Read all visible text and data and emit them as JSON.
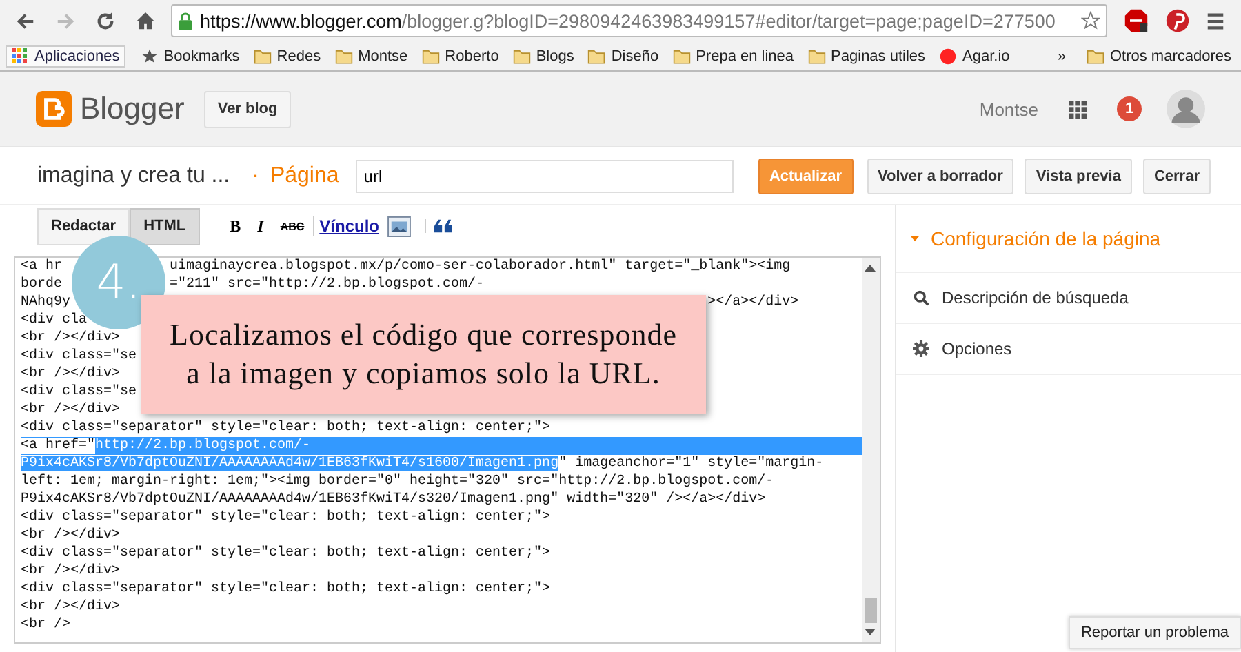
{
  "browser": {
    "url_host": "https://www.blogger.com",
    "url_path": "/blogger.g?blogID=2980942463983499157#editor/target=page;pageID=277500"
  },
  "bookmarks": [
    {
      "label": "Aplicaciones",
      "kind": "apps"
    },
    {
      "label": "Bookmarks",
      "kind": "star"
    },
    {
      "label": "Redes",
      "kind": "folder"
    },
    {
      "label": "Montse",
      "kind": "folder"
    },
    {
      "label": "Roberto",
      "kind": "folder"
    },
    {
      "label": "Blogs",
      "kind": "folder"
    },
    {
      "label": "Diseño",
      "kind": "folder"
    },
    {
      "label": "Prepa en linea",
      "kind": "folder"
    },
    {
      "label": "Paginas utiles",
      "kind": "folder"
    },
    {
      "label": "Agar.io",
      "kind": "site"
    }
  ],
  "bookmarks_more": "»",
  "other_bookmarks": "Otros marcadores",
  "header": {
    "brand": "Blogger",
    "view_blog": "Ver blog",
    "user": "Montse",
    "notifications": "1"
  },
  "editor": {
    "blog_title": "imagina y crea tu ...",
    "separator": "·",
    "page_label": "Página",
    "title_value": "url",
    "buttons": [
      {
        "label": "Actualizar",
        "primary": true
      },
      {
        "label": "Volver a borrador",
        "primary": false
      },
      {
        "label": "Vista previa",
        "primary": false
      },
      {
        "label": "Cerrar",
        "primary": false
      }
    ]
  },
  "modes": [
    {
      "label": "Redactar",
      "selected": false
    },
    {
      "label": "HTML",
      "selected": true
    }
  ],
  "format_tools": [
    {
      "kind": "bold",
      "label": "B"
    },
    {
      "kind": "italic",
      "label": "I"
    },
    {
      "kind": "strike",
      "label": "ABC"
    },
    {
      "kind": "link",
      "label": "Vínculo"
    },
    {
      "kind": "image"
    },
    {
      "kind": "quote"
    }
  ],
  "code_lines": [
    {
      "segments": [
        {
          "text": "<a hr",
          "selected": false
        }
      ],
      "tail": "uimaginaycrea.blogspot.mx/p/como-ser-colaborador.html\" target=\"_blank\"><img",
      "kind": "under_badge"
    },
    {
      "segments": [
        {
          "text": "borde",
          "selected": false
        }
      ],
      "tail": "=\"211\" src=\"http://2.bp.blogspot.com/-",
      "kind": "under_badge"
    },
    {
      "segments": [
        {
          "text": "NAhq9y",
          "selected": false
        }
      ],
      "tail": "></a></div>",
      "kind": "under_note"
    },
    {
      "segments": [
        {
          "text": "<div cla",
          "selected": false
        }
      ]
    },
    {
      "segments": [
        {
          "text": "<br /></div>",
          "selected": false
        }
      ]
    },
    {
      "segments": [
        {
          "text": "<div class=\"se",
          "selected": false
        }
      ]
    },
    {
      "segments": [
        {
          "text": "<br /></div>",
          "selected": false
        }
      ]
    },
    {
      "segments": [
        {
          "text": "<div class=\"se",
          "selected": false
        }
      ]
    },
    {
      "segments": [
        {
          "text": "<br /></div>",
          "selected": false
        }
      ]
    },
    {
      "segments": [
        {
          "text": "<div class=\"separator\" style=\"clear: both; text-align: center;\">",
          "selected": false
        }
      ]
    },
    {
      "segments": [
        {
          "text": "<a href=\"",
          "selected": false
        },
        {
          "text": "http://2.bp.blogspot.com/-",
          "selected": true
        }
      ],
      "fill": true
    },
    {
      "segments": [
        {
          "text": "P9ix4cAKSr8/Vb7dptOuZNI/AAAAAAAAd4w/1EB63fKwiT4/s1600/Imagen1.png",
          "selected": true
        },
        {
          "text": "\" imageanchor=\"1\" style=\"margin-",
          "selected": false
        }
      ]
    },
    {
      "segments": [
        {
          "text": "left: 1em; margin-right: 1em;\"><img border=\"0\" height=\"320\" src=\"http://2.bp.blogspot.com/-",
          "selected": false
        }
      ]
    },
    {
      "segments": [
        {
          "text": "P9ix4cAKSr8/Vb7dptOuZNI/AAAAAAAAd4w/1EB63fKwiT4/s320/Imagen1.png\" width=\"320\" /></a></div>",
          "selected": false
        }
      ]
    },
    {
      "segments": [
        {
          "text": "<div class=\"separator\" style=\"clear: both; text-align: center;\">",
          "selected": false
        }
      ]
    },
    {
      "segments": [
        {
          "text": "<br /></div>",
          "selected": false
        }
      ]
    },
    {
      "segments": [
        {
          "text": "<div class=\"separator\" style=\"clear: both; text-align: center;\">",
          "selected": false
        }
      ]
    },
    {
      "segments": [
        {
          "text": "<br /></div>",
          "selected": false
        }
      ]
    },
    {
      "segments": [
        {
          "text": "<div class=\"separator\" style=\"clear: both; text-align: center;\">",
          "selected": false
        }
      ]
    },
    {
      "segments": [
        {
          "text": "<br /></div>",
          "selected": false
        }
      ]
    },
    {
      "segments": [
        {
          "text": "<br />",
          "selected": false
        }
      ]
    }
  ],
  "annotation": {
    "step": "4.",
    "note": "Localizamos el código que corresponde a la imagen y copiamos solo la URL."
  },
  "sidebar": {
    "title": "Configuración de la página",
    "expanded": true,
    "items": [
      {
        "label": "Descripción de búsqueda",
        "kind": "search"
      },
      {
        "label": "Opciones",
        "kind": "gear"
      }
    ]
  },
  "report_button": "Reportar un problema"
}
